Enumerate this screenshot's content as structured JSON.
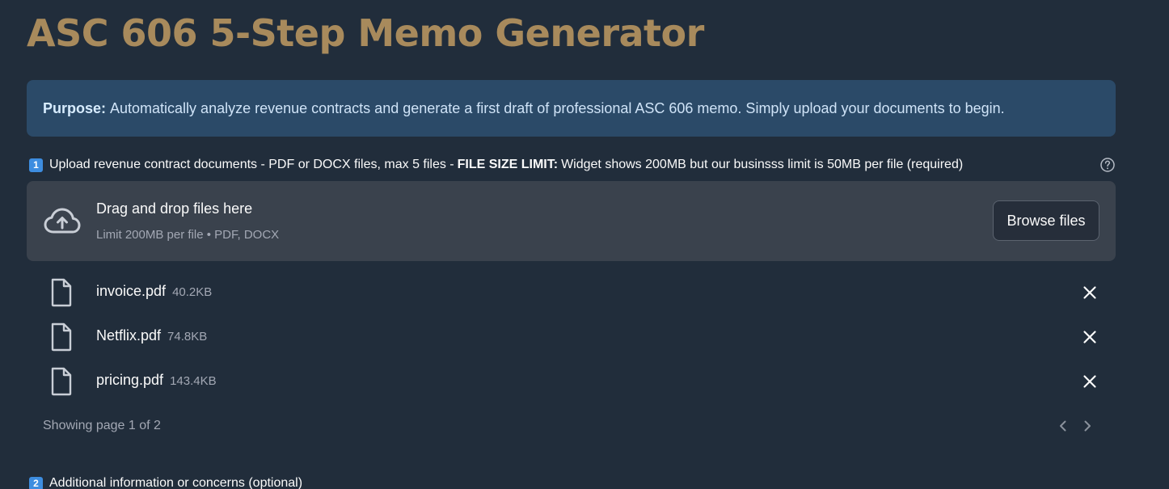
{
  "title": "ASC 606 5-Step Memo Generator",
  "purpose": {
    "label": "Purpose:",
    "text": "Automatically analyze revenue contracts and generate a first draft of professional ASC 606 memo. Simply upload your documents to begin."
  },
  "upload_label": {
    "keycap": "1",
    "text_before": "Upload revenue contract documents - PDF or DOCX files, max 5 files -",
    "bold": "FILE SIZE LIMIT:",
    "text_after": "Widget shows 200MB but our businsss limit is 50MB per file (required)",
    "help_icon": "question-circle-icon"
  },
  "dropzone": {
    "icon": "cloud-upload-icon",
    "title": "Drag and drop files here",
    "subtitle": "Limit 200MB per file • PDF, DOCX",
    "browse_label": "Browse files"
  },
  "files": [
    {
      "name": "invoice.pdf",
      "size": "40.2KB"
    },
    {
      "name": "Netflix.pdf",
      "size": "74.8KB"
    },
    {
      "name": "pricing.pdf",
      "size": "143.4KB"
    }
  ],
  "pagination": {
    "text": "Showing page 1 of 2",
    "current_page": 1,
    "total_pages": 2
  },
  "additional_label": {
    "keycap": "2",
    "text": "Additional information or concerns (optional)"
  },
  "colors": {
    "background": "#212d3b",
    "title": "#a88a5c",
    "info_box": "#2b4a68",
    "dropzone": "#3a424d",
    "keycap": "#3d8de0"
  }
}
